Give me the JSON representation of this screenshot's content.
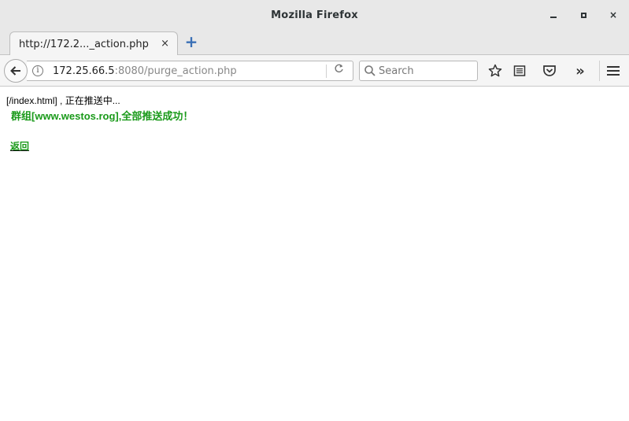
{
  "window": {
    "title": "Mozilla Firefox",
    "controls": {
      "minimize": "minimize-icon",
      "maximize": "maximize-icon",
      "close": "×"
    }
  },
  "tabs": [
    {
      "label": "http://172.2..._action.php",
      "close_label": "×"
    }
  ],
  "new_tab_label": "+",
  "navbar": {
    "url_host": "172.25.66.5",
    "url_rest": ":8080/purge_action.php",
    "search_placeholder": "Search",
    "icons": [
      "back-arrow-icon",
      "info-icon",
      "reload-icon",
      "search-icon",
      "bookmark-star-icon",
      "reader-list-icon",
      "pocket-icon",
      "overflow-chevrons-icon",
      "hamburger-menu-icon"
    ],
    "info_glyph": "i",
    "overflow_glyph": "»"
  },
  "page": {
    "status_line": "[/index.html] , 正在推送中...",
    "result_line": "群组[www.westos.rog],全部推送成功！",
    "back_link": "返回"
  },
  "colors": {
    "result_text": "#1a9a1a",
    "titlebar_bg": "#e8e8e8",
    "toolbar_bg": "#f5f5f5"
  }
}
